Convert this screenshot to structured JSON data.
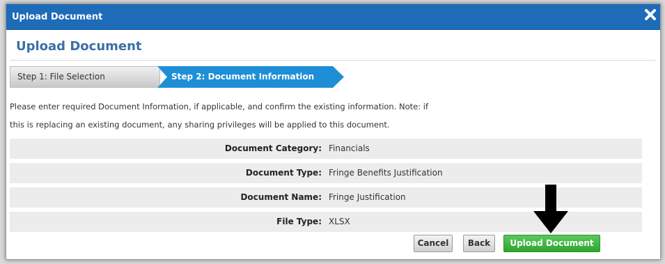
{
  "window": {
    "title": "Upload Document"
  },
  "header": {
    "title": "Upload Document"
  },
  "steps": [
    {
      "label": "Step 1: File Selection",
      "active": false
    },
    {
      "label": "Step 2: Document Information",
      "active": true
    }
  ],
  "instructions": {
    "line1": "Please enter required Document Information, if applicable, and confirm the existing information. Note: if",
    "line2": "this is replacing an existing document, any sharing privileges will be applied to this document."
  },
  "fields": [
    {
      "label": "Document Category:",
      "value": "Financials"
    },
    {
      "label": "Document Type:",
      "value": "Fringe Benefits Justification"
    },
    {
      "label": "Document Name:",
      "value": "Fringe Justification"
    },
    {
      "label": "File Type:",
      "value": "XLSX"
    }
  ],
  "buttons": {
    "cancel": "Cancel",
    "back": "Back",
    "upload": "Upload Document"
  },
  "icons": {
    "close": "close-icon",
    "annotation": "arrow-down-icon"
  },
  "colors": {
    "titlebar": "#1e6bb8",
    "active_step": "#1e8fd6",
    "upload_button": "#36b236",
    "heading": "#3b6fa6"
  }
}
